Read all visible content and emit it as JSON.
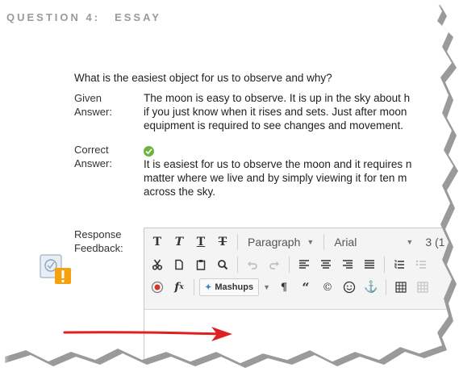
{
  "header": {
    "question_number": "QUESTION 4:",
    "question_type": "ESSAY"
  },
  "question": {
    "prompt": "What is the easiest object for us to observe and why?"
  },
  "given_answer": {
    "label_line1": "Given",
    "label_line2": "Answer:",
    "lines": [
      "The moon is easy to observe. It is up in the sky about h",
      "if you just know when it rises and sets. Just after moon",
      "equipment is required to see changes and movement."
    ]
  },
  "correct_answer": {
    "label_line1": "Correct",
    "label_line2": "Answer:",
    "icon": "check-circle-icon",
    "lines": [
      "It is easiest for us to observe the moon and it requires n",
      "matter where we live and by simply viewing it for ten m",
      "across the sky."
    ]
  },
  "response_feedback": {
    "label_line1": "Response",
    "label_line2": "Feedback:",
    "icon": "feedback-warning-icon"
  },
  "editor": {
    "row1": {
      "bold": "T",
      "italic": "T",
      "underline": "T",
      "strike": "T",
      "format_select": "Paragraph",
      "font_select": "Arial",
      "size_select": "3 (1"
    },
    "row3": {
      "mashups_label": "Mashups",
      "pilcrow": "¶",
      "quote": "“",
      "copyright": "©",
      "anchor": "⚓"
    }
  },
  "colors": {
    "header_gray": "#9a9a9a",
    "check_green": "#6db33f",
    "arrow_red": "#e02020",
    "warning_orange": "#f5a00e"
  }
}
